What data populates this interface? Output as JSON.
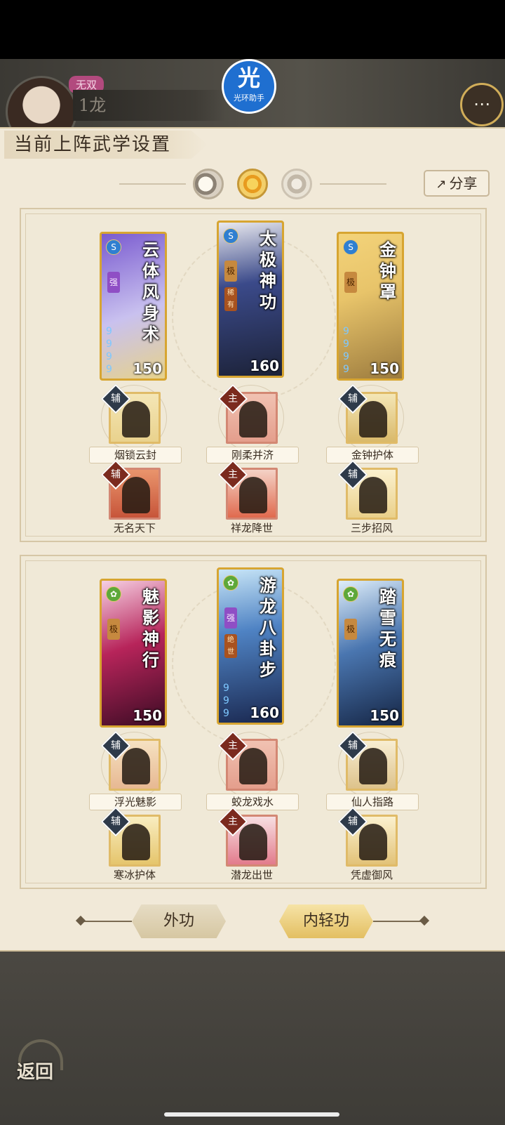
{
  "header": {
    "rank_badge": "无双",
    "player_name": "1龙",
    "app_logo_char": "光",
    "app_logo_name": "光环助手",
    "chat_icon": "chat-bubble-icon"
  },
  "panel": {
    "title": "当前上阵武学设置",
    "share_label": "分享",
    "selectors": [
      "moon-icon",
      "sun-icon",
      "ring-icon"
    ]
  },
  "sets": [
    {
      "cards": [
        {
          "title": "云体风身术",
          "grade": "强",
          "value": "150",
          "accent": "#7a5bd0"
        },
        {
          "title": "太极神功",
          "grade": "极",
          "tag": "稀有",
          "value": "160",
          "accent": "#3b4a8a"
        },
        {
          "title": "金钟罩",
          "grade": "极",
          "value": "150",
          "accent": "#d6a83a"
        }
      ],
      "skills_row1": [
        {
          "role": "辅",
          "name": "烟锁云封"
        },
        {
          "role": "主",
          "name": "刚柔并济"
        },
        {
          "role": "辅",
          "name": "金钟护体"
        }
      ],
      "skills_row2": [
        {
          "role": "辅",
          "name": "无名天下"
        },
        {
          "role": "主",
          "name": "祥龙降世"
        },
        {
          "role": "辅",
          "name": "三步招风"
        }
      ]
    },
    {
      "cards": [
        {
          "title": "魅影神行",
          "grade": "极",
          "value": "150",
          "accent": "#b7245a"
        },
        {
          "title": "游龙八卦步",
          "grade": "强",
          "tag": "绝世",
          "value": "160",
          "accent": "#23407a"
        },
        {
          "title": "踏雪无痕",
          "grade": "极",
          "value": "150",
          "accent": "#4a76b0"
        }
      ],
      "skills_row1": [
        {
          "role": "辅",
          "name": "浮光魅影"
        },
        {
          "role": "主",
          "name": "蛟龙戏水"
        },
        {
          "role": "辅",
          "name": "仙人指路"
        }
      ],
      "skills_row2": [
        {
          "role": "辅",
          "name": "寒冰护体"
        },
        {
          "role": "主",
          "name": "潜龙出世"
        },
        {
          "role": "辅",
          "name": "凭虚御风"
        }
      ]
    }
  ],
  "modes": {
    "outer": "外功",
    "inner": "内轻功",
    "active": "inner"
  },
  "footer": {
    "back_label": "返回"
  }
}
